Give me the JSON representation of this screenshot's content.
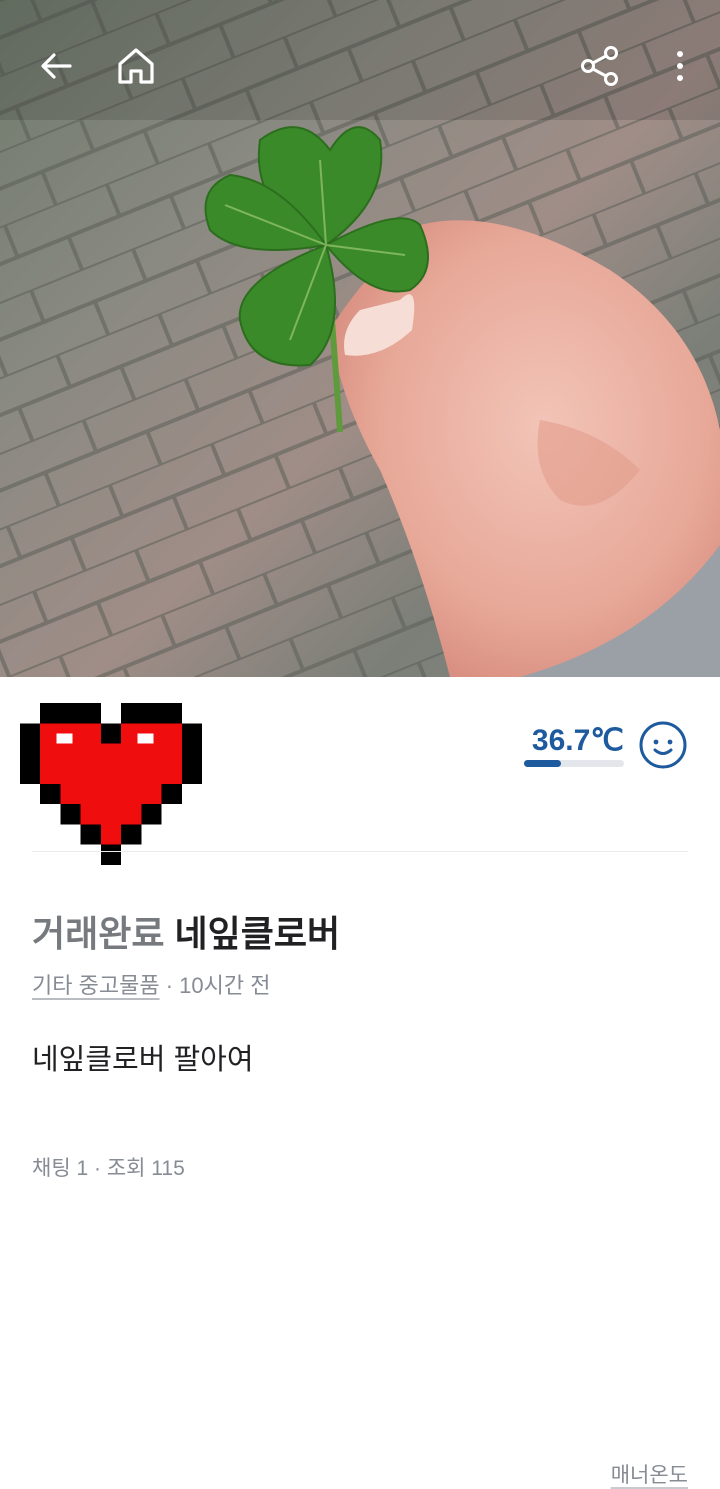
{
  "topbar": {
    "back_icon": "arrow-left-icon",
    "home_icon": "home-icon",
    "share_icon": "share-icon",
    "more_icon": "more-vertical-icon"
  },
  "seller": {
    "avatar": "pixel-heart-avatar",
    "manner_temperature": "36.7℃",
    "manner_temperature_value": 36.7,
    "manner_label": "매너온도",
    "temperature_color": "#1d5a9e",
    "face_icon": "smiling-face-icon"
  },
  "post": {
    "status": "거래완료",
    "title": "네잎클로버",
    "category": "기타 중고물품",
    "time_ago": "· 10시간 전",
    "description": "네잎클로버 팔아여",
    "stats": "채팅 1 · 조회 115"
  }
}
